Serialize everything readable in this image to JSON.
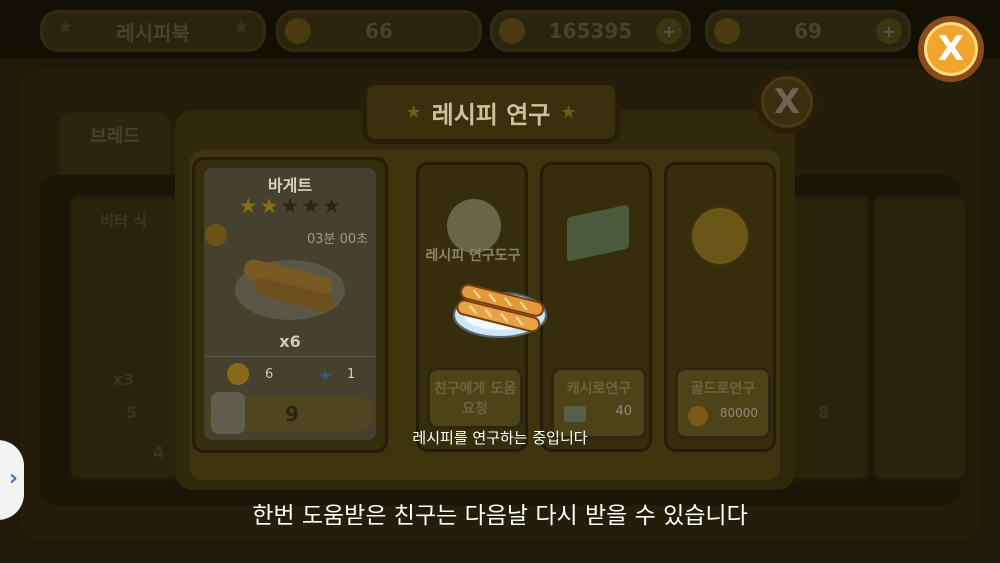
{
  "topbar": {
    "title": "레시피북",
    "resource1_value": "66",
    "resource2_value": "165395",
    "resource3_value": "69"
  },
  "background": {
    "tab_label": "브레드",
    "left_card_title": "버터 식",
    "left_card_count": "x3",
    "left_card_a": "5",
    "left_card_b": "4",
    "right_card_b": "8"
  },
  "modal": {
    "title": "레시피 연구",
    "recipe": {
      "name": "바게트",
      "timer": "03분 00초",
      "quantity": "x6",
      "coin_cost": "6",
      "gem_cost": "1",
      "jar_count": "9",
      "stars_filled": 2,
      "stars_total": 5
    },
    "option_research_tool_label": "레시피 연구도구",
    "option_friend_label": "친구에게 도움요청",
    "option_cash_label": "캐시로연구",
    "option_cash_price": "40",
    "option_gold_label": "골드로연구",
    "option_gold_price": "80000"
  },
  "toast": {
    "message": "레시피를 연구하는 중입니다"
  },
  "subtitle": {
    "text": "한번 도움받은 친구는 다음날 다시 받을 수 있습니다"
  },
  "colors": {
    "accent_orange": "#f1a52c",
    "close_border": "#8a4b1a",
    "overlay_dark": "#0c0a04"
  }
}
